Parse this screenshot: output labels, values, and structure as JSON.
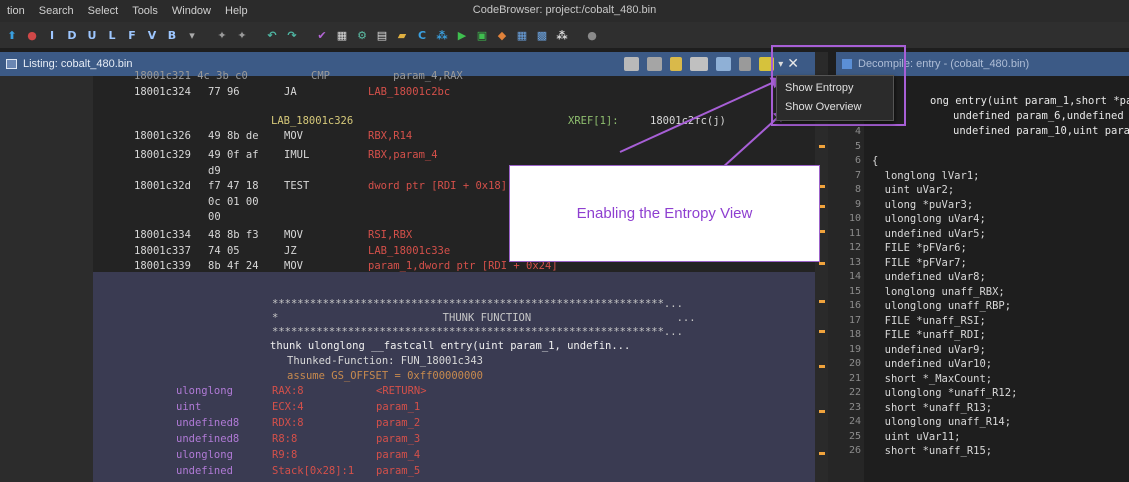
{
  "menubar": {
    "items": [
      "tion",
      "Search",
      "Select",
      "Tools",
      "Window",
      "Help"
    ],
    "title": "CodeBrowser: project:/cobalt_480.bin"
  },
  "toolbar": {
    "letters": [
      "I",
      "D",
      "U",
      "L",
      "F",
      "V",
      "B"
    ]
  },
  "listing": {
    "title": "Listing:  cobalt_480.bin",
    "top_rows": [
      {
        "addr": "18001c324",
        "bytes": "77 96",
        "mnem": "JA",
        "ops": "LAB_18001c2bc"
      },
      {
        "label": "LAB_18001c326",
        "xref": "XREF[1]:",
        "xref_target": "18001c2fc(j)"
      },
      {
        "addr": "18001c326",
        "bytes": "49 8b de",
        "mnem": "MOV",
        "ops": "RBX,R14"
      },
      {
        "addr": "18001c329",
        "bytes": "49 0f af",
        "mnem": "IMUL",
        "ops": "RBX,param_4"
      },
      {
        "bytes": "d9"
      },
      {
        "addr": "18001c32d",
        "bytes": "f7 47 18",
        "mnem": "TEST",
        "ops": "dword ptr [RDI + 0x18],"
      },
      {
        "bytes": "0c 01 00"
      },
      {
        "bytes": "00"
      },
      {
        "addr": "18001c334",
        "bytes": "48 8b f3",
        "mnem": "MOV",
        "ops": "RSI,RBX"
      },
      {
        "addr": "18001c337",
        "bytes": "74 05",
        "mnem": "JZ",
        "ops": "LAB_18001c33e"
      },
      {
        "addr": "18001c339",
        "bytes": "8b 4f 24",
        "mnem": "MOV",
        "ops": "param_1,dword ptr [RDI + 0x24]"
      }
    ],
    "top_partial": "18001c321 4c 3b c0          CMP          param_4,RAX",
    "thunk": {
      "stars": "**************************************************************...",
      "title_row": "*                          THUNK FUNCTION                       ...",
      "signature": "thunk ulonglong __fastcall entry(uint param_1, undefin...",
      "thunked": "Thunked-Function: FUN_18001c343",
      "assume": "assume GS_OFFSET = 0xff00000000"
    },
    "params": [
      {
        "type": "ulonglong",
        "storage": "RAX:8",
        "name": "<RETURN>"
      },
      {
        "type": "uint",
        "storage": "ECX:4",
        "name": "param_1"
      },
      {
        "type": "undefined8",
        "storage": "RDX:8",
        "name": "param_2"
      },
      {
        "type": "undefined8",
        "storage": "R8:8",
        "name": "param_3"
      },
      {
        "type": "ulonglong",
        "storage": "R9:8",
        "name": "param_4"
      },
      {
        "type": "undefined",
        "storage": "Stack[0x28]:1",
        "name": "param_5"
      }
    ]
  },
  "decompile": {
    "title": "Decompile: entry -  (cobalt_480.bin)",
    "header_lines": [
      "ong entry(uint param_1,short *param_",
      "undefined param_6,undefined",
      "undefined param_10,uint para"
    ],
    "lines": [
      {
        "n": "4",
        "code": ""
      },
      {
        "n": "5",
        "code": ""
      },
      {
        "n": "6",
        "code": "{"
      },
      {
        "n": "7",
        "code": "  longlong lVar1;"
      },
      {
        "n": "8",
        "code": "  uint uVar2;"
      },
      {
        "n": "9",
        "code": "  ulong *puVar3;"
      },
      {
        "n": "10",
        "code": "  ulonglong uVar4;"
      },
      {
        "n": "11",
        "code": "  undefined uVar5;"
      },
      {
        "n": "12",
        "code": "  FILE *pFVar6;"
      },
      {
        "n": "13",
        "code": "  FILE *pFVar7;"
      },
      {
        "n": "14",
        "code": "  undefined uVar8;"
      },
      {
        "n": "15",
        "code": "  longlong unaff_RBX;"
      },
      {
        "n": "16",
        "code": "  ulonglong unaff_RBP;"
      },
      {
        "n": "17",
        "code": "  FILE *unaff_RSI;"
      },
      {
        "n": "18",
        "code": "  FILE *unaff_RDI;"
      },
      {
        "n": "19",
        "code": "  undefined uVar9;"
      },
      {
        "n": "20",
        "code": "  undefined uVar10;"
      },
      {
        "n": "21",
        "code": "  short *_MaxCount;"
      },
      {
        "n": "22",
        "code": "  ulonglong *unaff_R12;"
      },
      {
        "n": "23",
        "code": "  short *unaff_R13;"
      },
      {
        "n": "24",
        "code": "  ulonglong unaff_R14;"
      },
      {
        "n": "25",
        "code": "  uint uVar11;"
      },
      {
        "n": "26",
        "code": "  short *unaff_R15;"
      }
    ]
  },
  "dropdown": {
    "options": [
      "Show Entropy",
      "Show Overview"
    ]
  },
  "callout": {
    "text": "Enabling the Entropy View"
  },
  "colors": {
    "accent_purple": "#a75fd6",
    "header_blue": "#3c5a86",
    "address": "#d8d8d8",
    "mnemonic": "#d8d8d8",
    "operand_red": "#d4504a",
    "label_yellow": "#d6c97a",
    "type_purple": "#b07ad6",
    "scroll_marker": "#f0a33c"
  }
}
